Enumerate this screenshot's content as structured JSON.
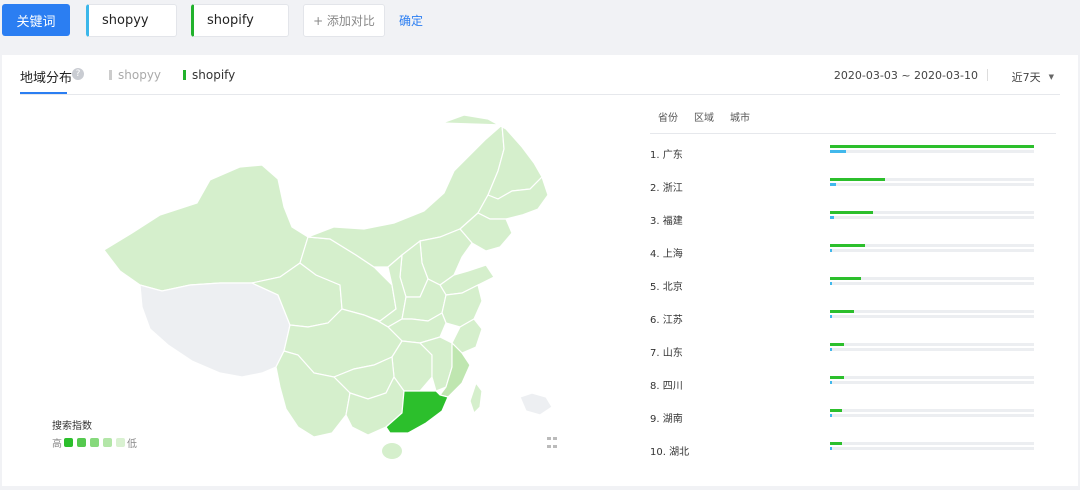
{
  "toolbar": {
    "keyword_button": "关键词",
    "keyword_a": "shopyy",
    "keyword_b": "shopify",
    "add_compare": "+ 添加对比",
    "confirm": "确定"
  },
  "panel": {
    "tab_title": "地域分布",
    "help_icon": "?",
    "legend_a": "shopyy",
    "legend_b": "shopify",
    "date_range": "2020-03-03 ~ 2020-03-10",
    "period": "近7天",
    "period_caret": "▼"
  },
  "map_legend": {
    "title": "搜索指数",
    "high": "高",
    "low": "低",
    "scale_colors": [
      "#2cbf2c",
      "#55c94f",
      "#86d97c",
      "#b3e6a8",
      "#d9f1d1"
    ]
  },
  "ranking": {
    "headers": [
      "省份",
      "区域",
      "城市"
    ],
    "rows": [
      {
        "label": "1.  广东",
        "shopify": 1.0,
        "shopyy": 0.08
      },
      {
        "label": "2.  浙江",
        "shopify": 0.27,
        "shopyy": 0.03
      },
      {
        "label": "3.  福建",
        "shopify": 0.21,
        "shopyy": 0.02
      },
      {
        "label": "4.  上海",
        "shopify": 0.17,
        "shopyy": 0.01
      },
      {
        "label": "5.  北京",
        "shopify": 0.15,
        "shopyy": 0.01
      },
      {
        "label": "6.  江苏",
        "shopify": 0.12,
        "shopyy": 0.01
      },
      {
        "label": "7.  山东",
        "shopify": 0.07,
        "shopyy": 0.01
      },
      {
        "label": "8.  四川",
        "shopify": 0.07,
        "shopyy": 0.01
      },
      {
        "label": "9.  湖南",
        "shopify": 0.06,
        "shopyy": 0.01
      },
      {
        "label": "10. 湖北",
        "shopify": 0.06,
        "shopyy": 0.01
      }
    ]
  },
  "colors": {
    "accent": "#2b7ef2",
    "shopyy": "#41b8ec",
    "shopify": "#2cbf2c"
  }
}
